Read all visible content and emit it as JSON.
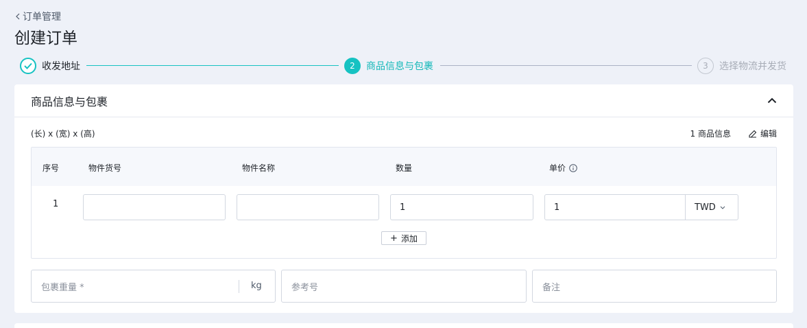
{
  "header": {
    "back_label": "订单管理",
    "title": "创建订单"
  },
  "steps": [
    {
      "index": "1",
      "label": "收发地址",
      "status": "done"
    },
    {
      "index": "2",
      "label": "商品信息与包裹",
      "status": "active"
    },
    {
      "index": "3",
      "label": "选择物流并发货",
      "status": "pending"
    }
  ],
  "colors": {
    "accent": "#16c2c2",
    "page_bg": "#eef1f8",
    "muted": "#a8adb7"
  },
  "card": {
    "title": "商品信息与包裹",
    "dimension_label": "(长) x (宽) x (高)",
    "item_count_label": "1 商品信息",
    "edit_label": "编辑",
    "table": {
      "columns": [
        "序号",
        "物件货号",
        "物件名称",
        "数量",
        "单价"
      ],
      "rows": [
        {
          "index": "1",
          "sku": "",
          "name": "",
          "quantity": "1",
          "unit_price": "1",
          "currency": "TWD"
        }
      ],
      "add_label": "添加"
    },
    "package": {
      "weight_placeholder": "包裹重量 *",
      "weight_unit": "kg",
      "reference_placeholder": "参考号",
      "remark_placeholder": "备注"
    }
  }
}
